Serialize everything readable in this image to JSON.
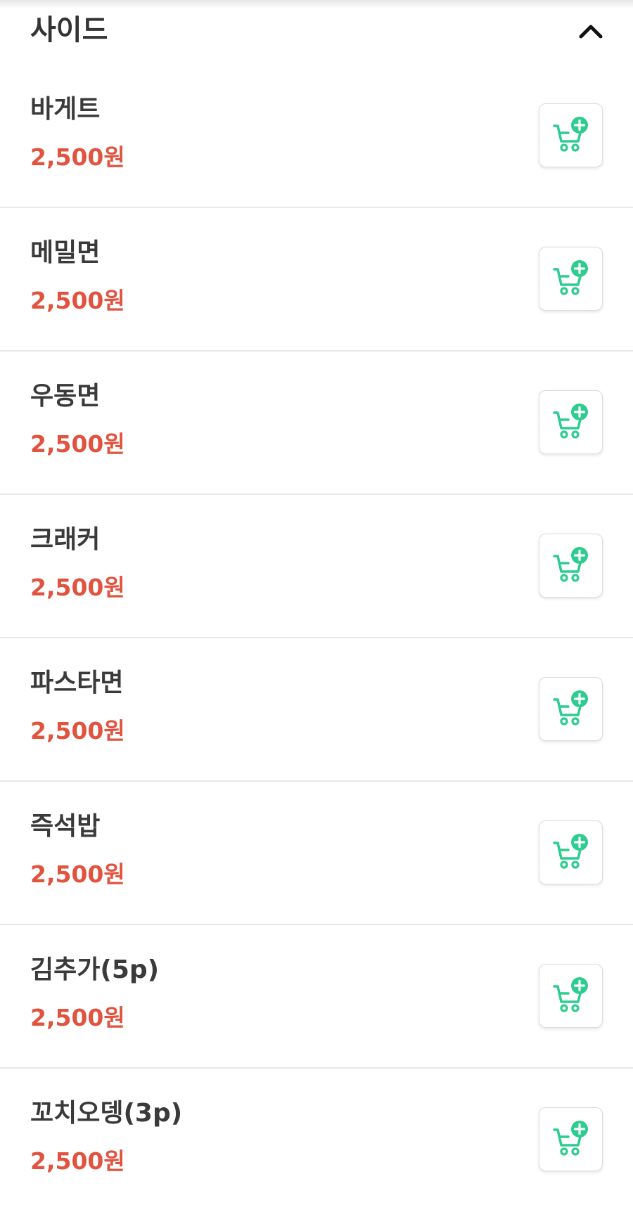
{
  "section": {
    "title": "사이드",
    "collapse_icon": "chevron-up-icon"
  },
  "colors": {
    "price": "#e0533f",
    "cart_accent": "#2ecc8f",
    "title": "#333333"
  },
  "items": [
    {
      "name": "바게트",
      "price": "2,500원",
      "icon": "cart-add-icon"
    },
    {
      "name": "메밀면",
      "price": "2,500원",
      "icon": "cart-add-icon"
    },
    {
      "name": "우동면",
      "price": "2,500원",
      "icon": "cart-add-icon"
    },
    {
      "name": "크래커",
      "price": "2,500원",
      "icon": "cart-add-icon"
    },
    {
      "name": "파스타면",
      "price": "2,500원",
      "icon": "cart-add-icon"
    },
    {
      "name": "즉석밥",
      "price": "2,500원",
      "icon": "cart-add-icon"
    },
    {
      "name": "김추가(5p)",
      "price": "2,500원",
      "icon": "cart-add-icon"
    },
    {
      "name": "꼬치오뎅(3p)",
      "price": "2,500원",
      "icon": "cart-add-icon"
    }
  ]
}
